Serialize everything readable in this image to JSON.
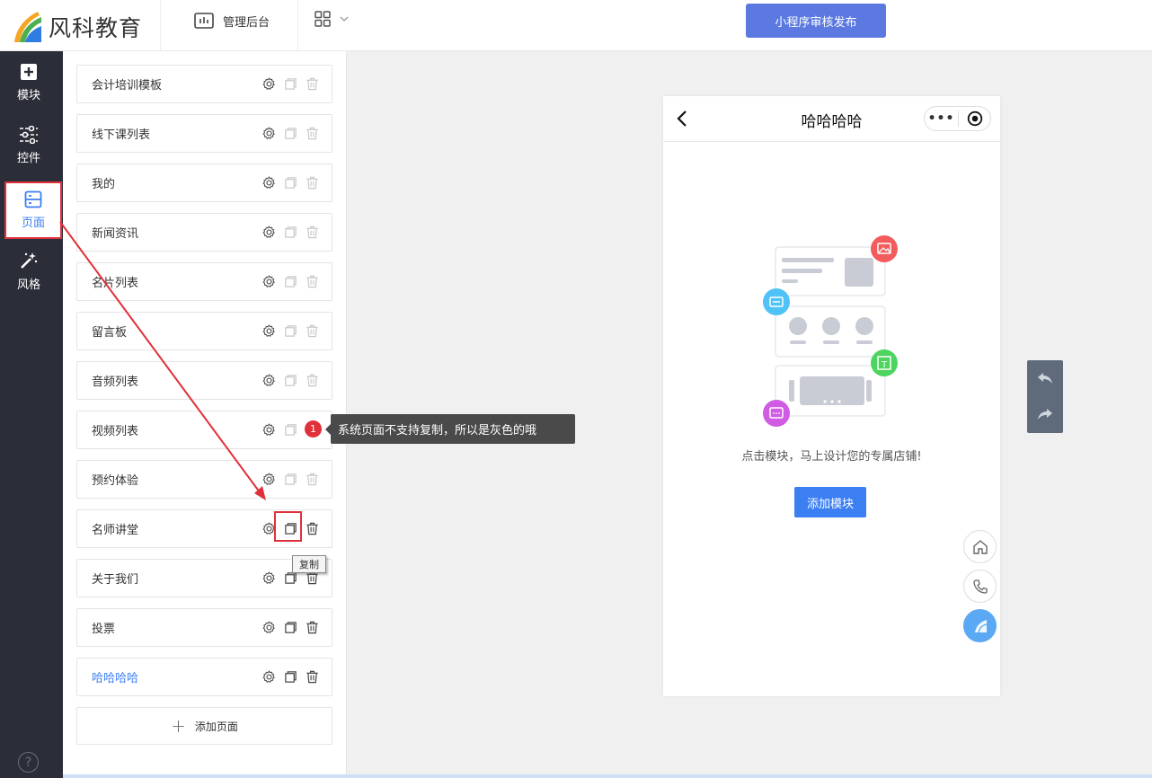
{
  "header": {
    "logo_text": "风科教育",
    "admin_label": "管理后台",
    "publish_label": "小程序审核发布"
  },
  "sidebar": {
    "items": [
      {
        "label": "模块",
        "icon": "plus-square-icon"
      },
      {
        "label": "控件",
        "icon": "sliders-icon"
      },
      {
        "label": "页面",
        "icon": "page-list-icon",
        "active": true
      },
      {
        "label": "风格",
        "icon": "magic-wand-icon"
      }
    ],
    "help": "?"
  },
  "pages": {
    "items": [
      {
        "label": "会计培训模板",
        "copy_enabled": false,
        "delete_enabled": false
      },
      {
        "label": "线下课列表",
        "copy_enabled": false,
        "delete_enabled": false
      },
      {
        "label": "我的",
        "copy_enabled": false,
        "delete_enabled": false
      },
      {
        "label": "新闻资讯",
        "copy_enabled": false,
        "delete_enabled": false
      },
      {
        "label": "名片列表",
        "copy_enabled": false,
        "delete_enabled": false
      },
      {
        "label": "留言板",
        "copy_enabled": false,
        "delete_enabled": false
      },
      {
        "label": "音频列表",
        "copy_enabled": false,
        "delete_enabled": false
      },
      {
        "label": "视频列表",
        "copy_enabled": false,
        "delete_enabled": false
      },
      {
        "label": "预约体验",
        "copy_enabled": false,
        "delete_enabled": false
      },
      {
        "label": "名师讲堂",
        "copy_enabled": true,
        "delete_enabled": true
      },
      {
        "label": "关于我们",
        "copy_enabled": true,
        "delete_enabled": true
      },
      {
        "label": "投票",
        "copy_enabled": true,
        "delete_enabled": true
      },
      {
        "label": "哈哈哈哈",
        "copy_enabled": true,
        "delete_enabled": true,
        "selected": true
      }
    ],
    "add_label": "添加页面"
  },
  "annotation": {
    "badge": "1",
    "tip": "系统页面不支持复制，所以是灰色的哦",
    "copy_tooltip": "复制"
  },
  "preview": {
    "title": "哈哈哈哈",
    "capsule_dots": "•••",
    "hint": "点击模块，马上设计您的专属店铺!",
    "add_module": "添加模块"
  },
  "colors": {
    "accent": "#3b7ff3",
    "publish": "#5b79e0",
    "sidebar_bg": "#2b2e38",
    "annotation_red": "#e0303a"
  }
}
